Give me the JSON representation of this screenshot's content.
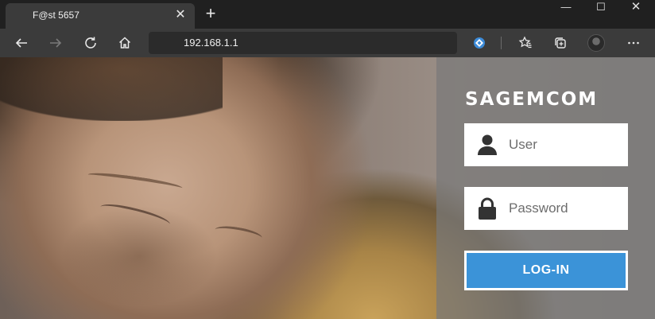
{
  "browser": {
    "tab_title": "F@st 5657",
    "tab_close": "✕",
    "new_tab": "+",
    "url": "192.168.1.1",
    "window": {
      "minimize": "—",
      "maximize": "☐",
      "close": "✕"
    }
  },
  "login": {
    "brand": "Sagemcom",
    "user_placeholder": "User",
    "password_placeholder": "Password",
    "login_button": "LOG-IN"
  },
  "colors": {
    "accent": "#3b93d8",
    "panel": "#787878",
    "chrome": "#3b3b3b"
  }
}
